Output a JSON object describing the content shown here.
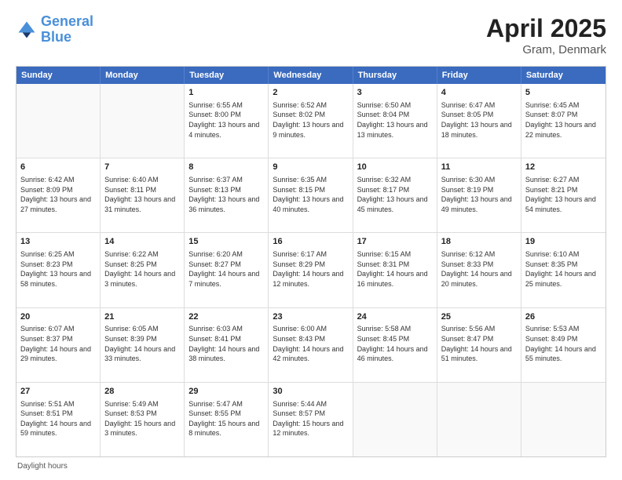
{
  "header": {
    "logo_line1": "General",
    "logo_line2": "Blue",
    "title": "April 2025",
    "subtitle": "Gram, Denmark"
  },
  "calendar": {
    "days_of_week": [
      "Sunday",
      "Monday",
      "Tuesday",
      "Wednesday",
      "Thursday",
      "Friday",
      "Saturday"
    ],
    "rows": [
      [
        {
          "day": "",
          "text": ""
        },
        {
          "day": "",
          "text": ""
        },
        {
          "day": "1",
          "text": "Sunrise: 6:55 AM\nSunset: 8:00 PM\nDaylight: 13 hours and 4 minutes."
        },
        {
          "day": "2",
          "text": "Sunrise: 6:52 AM\nSunset: 8:02 PM\nDaylight: 13 hours and 9 minutes."
        },
        {
          "day": "3",
          "text": "Sunrise: 6:50 AM\nSunset: 8:04 PM\nDaylight: 13 hours and 13 minutes."
        },
        {
          "day": "4",
          "text": "Sunrise: 6:47 AM\nSunset: 8:05 PM\nDaylight: 13 hours and 18 minutes."
        },
        {
          "day": "5",
          "text": "Sunrise: 6:45 AM\nSunset: 8:07 PM\nDaylight: 13 hours and 22 minutes."
        }
      ],
      [
        {
          "day": "6",
          "text": "Sunrise: 6:42 AM\nSunset: 8:09 PM\nDaylight: 13 hours and 27 minutes."
        },
        {
          "day": "7",
          "text": "Sunrise: 6:40 AM\nSunset: 8:11 PM\nDaylight: 13 hours and 31 minutes."
        },
        {
          "day": "8",
          "text": "Sunrise: 6:37 AM\nSunset: 8:13 PM\nDaylight: 13 hours and 36 minutes."
        },
        {
          "day": "9",
          "text": "Sunrise: 6:35 AM\nSunset: 8:15 PM\nDaylight: 13 hours and 40 minutes."
        },
        {
          "day": "10",
          "text": "Sunrise: 6:32 AM\nSunset: 8:17 PM\nDaylight: 13 hours and 45 minutes."
        },
        {
          "day": "11",
          "text": "Sunrise: 6:30 AM\nSunset: 8:19 PM\nDaylight: 13 hours and 49 minutes."
        },
        {
          "day": "12",
          "text": "Sunrise: 6:27 AM\nSunset: 8:21 PM\nDaylight: 13 hours and 54 minutes."
        }
      ],
      [
        {
          "day": "13",
          "text": "Sunrise: 6:25 AM\nSunset: 8:23 PM\nDaylight: 13 hours and 58 minutes."
        },
        {
          "day": "14",
          "text": "Sunrise: 6:22 AM\nSunset: 8:25 PM\nDaylight: 14 hours and 3 minutes."
        },
        {
          "day": "15",
          "text": "Sunrise: 6:20 AM\nSunset: 8:27 PM\nDaylight: 14 hours and 7 minutes."
        },
        {
          "day": "16",
          "text": "Sunrise: 6:17 AM\nSunset: 8:29 PM\nDaylight: 14 hours and 12 minutes."
        },
        {
          "day": "17",
          "text": "Sunrise: 6:15 AM\nSunset: 8:31 PM\nDaylight: 14 hours and 16 minutes."
        },
        {
          "day": "18",
          "text": "Sunrise: 6:12 AM\nSunset: 8:33 PM\nDaylight: 14 hours and 20 minutes."
        },
        {
          "day": "19",
          "text": "Sunrise: 6:10 AM\nSunset: 8:35 PM\nDaylight: 14 hours and 25 minutes."
        }
      ],
      [
        {
          "day": "20",
          "text": "Sunrise: 6:07 AM\nSunset: 8:37 PM\nDaylight: 14 hours and 29 minutes."
        },
        {
          "day": "21",
          "text": "Sunrise: 6:05 AM\nSunset: 8:39 PM\nDaylight: 14 hours and 33 minutes."
        },
        {
          "day": "22",
          "text": "Sunrise: 6:03 AM\nSunset: 8:41 PM\nDaylight: 14 hours and 38 minutes."
        },
        {
          "day": "23",
          "text": "Sunrise: 6:00 AM\nSunset: 8:43 PM\nDaylight: 14 hours and 42 minutes."
        },
        {
          "day": "24",
          "text": "Sunrise: 5:58 AM\nSunset: 8:45 PM\nDaylight: 14 hours and 46 minutes."
        },
        {
          "day": "25",
          "text": "Sunrise: 5:56 AM\nSunset: 8:47 PM\nDaylight: 14 hours and 51 minutes."
        },
        {
          "day": "26",
          "text": "Sunrise: 5:53 AM\nSunset: 8:49 PM\nDaylight: 14 hours and 55 minutes."
        }
      ],
      [
        {
          "day": "27",
          "text": "Sunrise: 5:51 AM\nSunset: 8:51 PM\nDaylight: 14 hours and 59 minutes."
        },
        {
          "day": "28",
          "text": "Sunrise: 5:49 AM\nSunset: 8:53 PM\nDaylight: 15 hours and 3 minutes."
        },
        {
          "day": "29",
          "text": "Sunrise: 5:47 AM\nSunset: 8:55 PM\nDaylight: 15 hours and 8 minutes."
        },
        {
          "day": "30",
          "text": "Sunrise: 5:44 AM\nSunset: 8:57 PM\nDaylight: 15 hours and 12 minutes."
        },
        {
          "day": "",
          "text": ""
        },
        {
          "day": "",
          "text": ""
        },
        {
          "day": "",
          "text": ""
        }
      ]
    ]
  },
  "footer": {
    "text": "Daylight hours"
  }
}
